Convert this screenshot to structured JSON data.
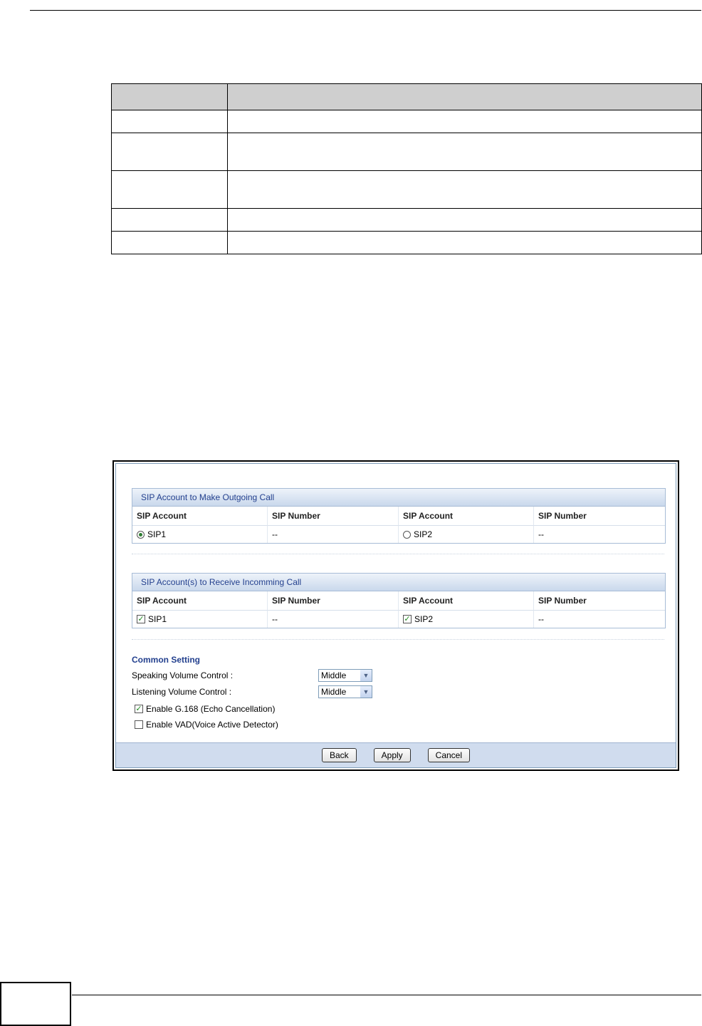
{
  "doc_table": {
    "rows": [
      {
        "type": "header"
      },
      {
        "type": "short"
      },
      {
        "type": "tall"
      },
      {
        "type": "tall"
      },
      {
        "type": "short"
      },
      {
        "type": "short"
      }
    ]
  },
  "outgoing": {
    "title": "SIP Account to Make Outgoing Call",
    "headers": [
      "SIP Account",
      "SIP Number",
      "SIP Account",
      "SIP Number"
    ],
    "row": {
      "acct1": "SIP1",
      "num1": "--",
      "acct2": "SIP2",
      "num2": "--",
      "selected": "SIP1"
    }
  },
  "incoming": {
    "title": "SIP Account(s) to Receive Incomming Call",
    "headers": [
      "SIP Account",
      "SIP Number",
      "SIP Account",
      "SIP Number"
    ],
    "row": {
      "acct1": "SIP1",
      "num1": "--",
      "acct2": "SIP2",
      "num2": "--",
      "checked1": true,
      "checked2": true
    }
  },
  "common": {
    "title": "Common Setting",
    "speaking_label": "Speaking Volume Control :",
    "speaking_value": "Middle",
    "listening_label": "Listening Volume Control :",
    "listening_value": "Middle",
    "g168_label": "Enable G.168 (Echo Cancellation)",
    "g168_checked": true,
    "vad_label": "Enable VAD(Voice Active Detector)",
    "vad_checked": false
  },
  "buttons": {
    "back": "Back",
    "apply": "Apply",
    "cancel": "Cancel"
  }
}
